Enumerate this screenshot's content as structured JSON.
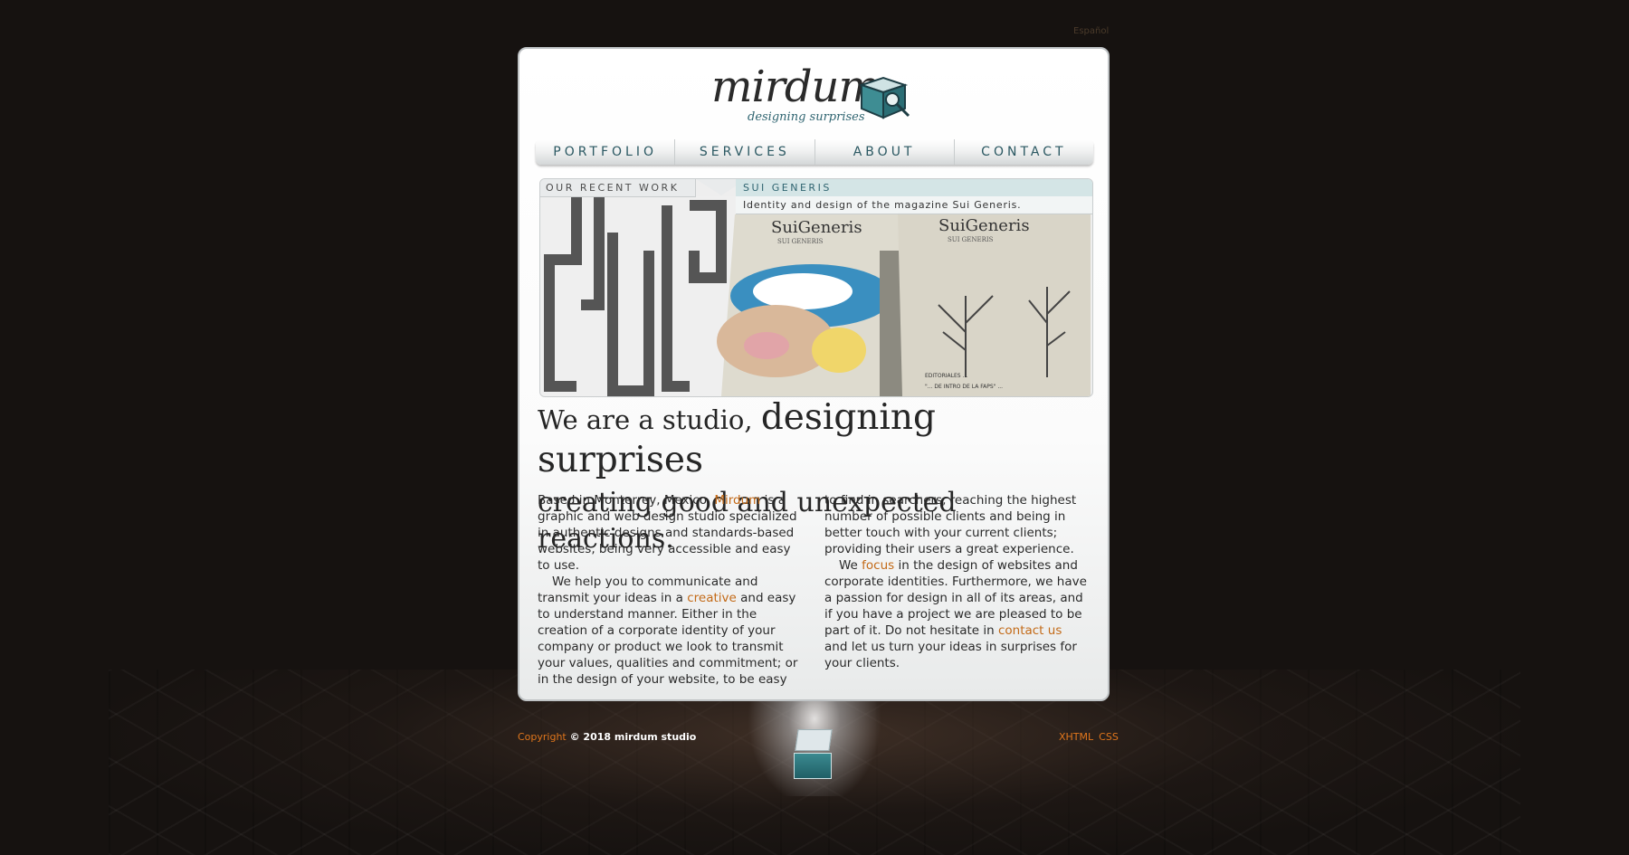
{
  "language_link": "Español",
  "logo": {
    "word": "mirdum",
    "tagline": "designing surprises"
  },
  "nav": [
    "PORTFOLIO",
    "SERVICES",
    "ABOUT",
    "CONTACT"
  ],
  "featured": {
    "section_label": "OUR RECENT WORK",
    "title": "SUI GENERIS",
    "description": "Identity and design of the magazine Sui Generis.",
    "cover_title": "SuiGeneris",
    "cover_subtitle": "SUI GENERIS",
    "caption_1": "EDITORIALES ...",
    "caption_2": "\"... DE INTRO DE LA FAPS\" ..."
  },
  "headline": {
    "part1": "We are a studio, ",
    "part2": "designing surprises",
    "part3": "creating good and unexpected reactions."
  },
  "body": {
    "p1_before": "Based in Monterrey, Mexico. ",
    "p1_link": "Mirdum",
    "p1_after": " is a graphic and web design studio specialized in authentic designs and standards-based websites, being very accessible and easy to use.",
    "p2_before": "We help you to communicate and transmit your ideas in a ",
    "p2_link": "creative",
    "p2_after": " and easy to understand manner. Either in the creation of a corporate identity of your company or product we look to transmit your values, qualities and commitment; or in the design of your website, to be easy",
    "p3": "to find in searchers, reaching the highest number of possible clients and being in better touch with your current clients; providing their users a great experience.",
    "p4_before": "We ",
    "p4_link": "focus",
    "p4_after": " in the design of websites and corporate identities. Furthermore, we have a passion for design in all of its areas, and if you have a project we are pleased to be part of it. Do not hesitate in ",
    "p4_link2": "contact us",
    "p4_end": " and let us turn your ideas in surprises for your clients."
  },
  "footer": {
    "copyright_link": "Copyright",
    "copyright_text": " © 2018 mirdum studio",
    "links": [
      "XHTML",
      "CSS"
    ]
  },
  "colors": {
    "accent": "#c36a17",
    "teal": "#2f6470",
    "background": "#161210"
  }
}
